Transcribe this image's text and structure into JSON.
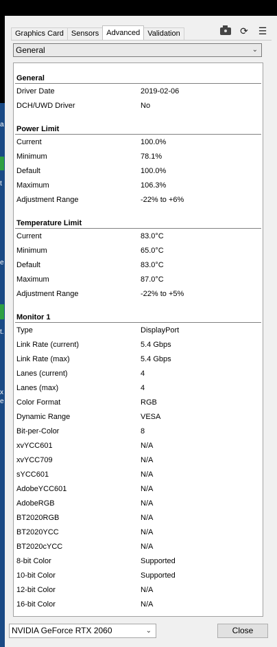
{
  "tabs": [
    "Graphics Card",
    "Sensors",
    "Advanced",
    "Validation"
  ],
  "active_tab": "Advanced",
  "category_select": "General",
  "sections": [
    {
      "title": "General",
      "rows": [
        {
          "k": "Driver Date",
          "v": "2019-02-06"
        },
        {
          "k": "DCH/UWD Driver",
          "v": "No"
        }
      ]
    },
    {
      "title": "Power Limit",
      "rows": [
        {
          "k": "Current",
          "v": "100.0%"
        },
        {
          "k": "Minimum",
          "v": "78.1%"
        },
        {
          "k": "Default",
          "v": "100.0%"
        },
        {
          "k": "Maximum",
          "v": "106.3%"
        },
        {
          "k": "Adjustment Range",
          "v": "-22% to +6%"
        }
      ]
    },
    {
      "title": "Temperature Limit",
      "rows": [
        {
          "k": "Current",
          "v": "83.0°C"
        },
        {
          "k": "Minimum",
          "v": "65.0°C"
        },
        {
          "k": "Default",
          "v": "83.0°C"
        },
        {
          "k": "Maximum",
          "v": "87.0°C"
        },
        {
          "k": "Adjustment Range",
          "v": "-22% to +5%"
        }
      ]
    },
    {
      "title": "Monitor 1",
      "rows": [
        {
          "k": "Type",
          "v": "DisplayPort"
        },
        {
          "k": "Link Rate (current)",
          "v": "5.4 Gbps"
        },
        {
          "k": "Link Rate (max)",
          "v": "5.4 Gbps"
        },
        {
          "k": "Lanes (current)",
          "v": "4"
        },
        {
          "k": "Lanes (max)",
          "v": "4"
        },
        {
          "k": "Color Format",
          "v": "RGB"
        },
        {
          "k": "Dynamic Range",
          "v": "VESA"
        },
        {
          "k": "Bit-per-Color",
          "v": "8"
        },
        {
          "k": "xvYCC601",
          "v": "N/A"
        },
        {
          "k": "xvYCC709",
          "v": "N/A"
        },
        {
          "k": "sYCC601",
          "v": "N/A"
        },
        {
          "k": "AdobeYCC601",
          "v": "N/A"
        },
        {
          "k": "AdobeRGB",
          "v": "N/A"
        },
        {
          "k": "BT2020RGB",
          "v": "N/A"
        },
        {
          "k": "BT2020YCC",
          "v": "N/A"
        },
        {
          "k": "BT2020cYCC",
          "v": "N/A"
        },
        {
          "k": "8-bit Color",
          "v": "Supported"
        },
        {
          "k": "10-bit Color",
          "v": "Supported"
        },
        {
          "k": "12-bit Color",
          "v": "N/A"
        },
        {
          "k": "16-bit Color",
          "v": "N/A"
        }
      ]
    }
  ],
  "gpu_select": "NVIDIA GeForce RTX 2060",
  "close_label": "Close",
  "icons": {
    "camera": "camera-icon",
    "refresh": "refresh-icon",
    "menu": "menu-icon"
  },
  "bg_letters": [
    "a",
    "t",
    "e",
    "t.",
    "x",
    "e"
  ]
}
